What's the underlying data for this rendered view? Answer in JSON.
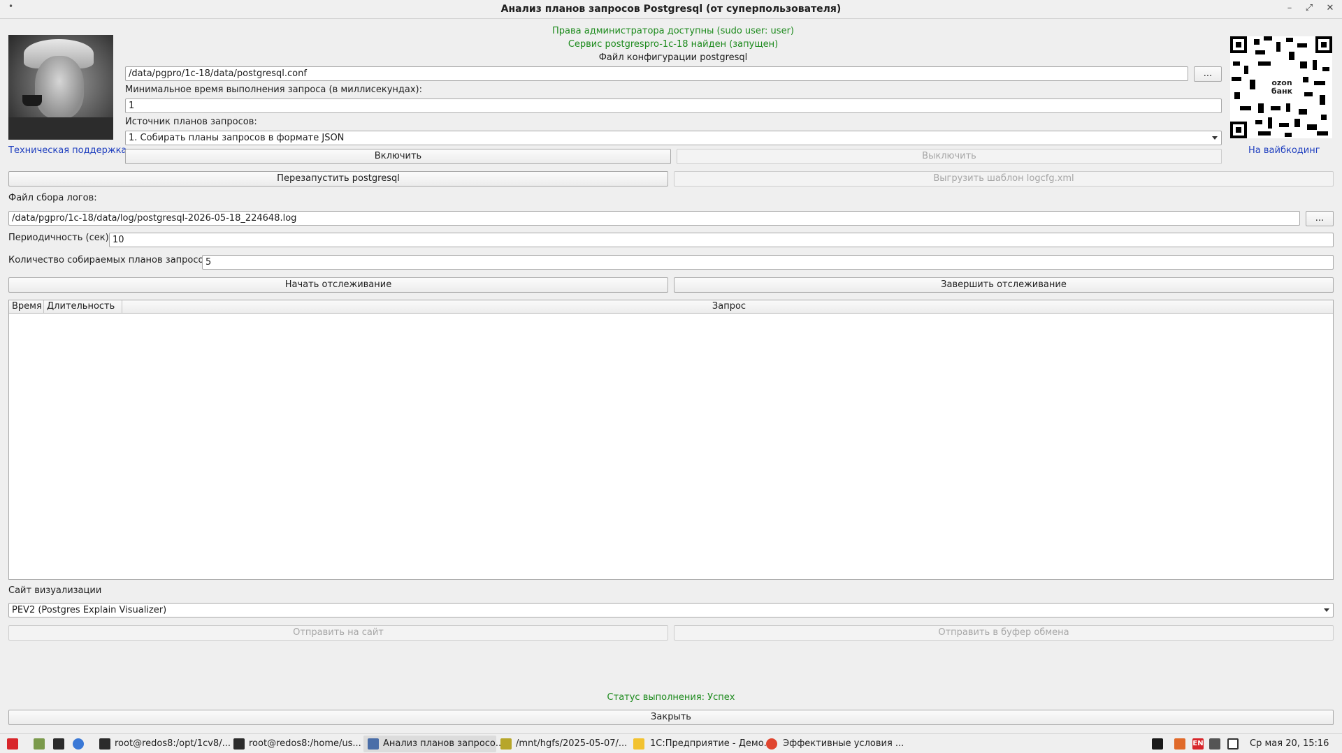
{
  "window": {
    "title": "Анализ планов запросов Postgresql (от суперпользователя)",
    "dot": "•",
    "minimize": "–",
    "maximize": "⤢",
    "close": "✕"
  },
  "status_lines": {
    "admin": "Права администратора доступны (sudo user: user)",
    "service": "Сервис postgrespro-1c-18 найден (запущен)",
    "config_label": "Файл конфигурации postgresql"
  },
  "support_link": "Техническая поддержка",
  "donate_link": "На вайбкодинг",
  "qr_brand": {
    "line1": "ozon",
    "line2": "банк"
  },
  "config": {
    "path": "/data/pgpro/1c-18/data/postgresql.conf",
    "browse": "..."
  },
  "min_time": {
    "label": "Минимальное время выполнения запроса (в миллисекундах):",
    "value": "1"
  },
  "plan_source": {
    "label": "Источник планов запросов:",
    "selected": "1. Собирать планы запросов в формате JSON"
  },
  "buttons": {
    "enable": "Включить",
    "disable": "Выключить",
    "restart": "Перезапустить postgresql",
    "export_template": "Выгрузить шаблон logcfg.xml",
    "start_tracking": "Начать отслеживание",
    "stop_tracking": "Завершить отслеживание",
    "send_site": "Отправить на сайт",
    "send_clipboard": "Отправить в буфер обмена",
    "close": "Закрыть"
  },
  "log_file": {
    "label": "Файл сбора логов:",
    "path": "/data/pgpro/1c-18/data/log/postgresql-2026-05-18_224648.log",
    "browse": "..."
  },
  "period": {
    "label": "Периодичность (сек):",
    "value": "10"
  },
  "plans_count": {
    "label": "Количество собираемых планов запросов:",
    "value": "5"
  },
  "table": {
    "columns": [
      "Время",
      "Длительность",
      "Запрос"
    ],
    "rows": []
  },
  "visualizer": {
    "label": "Сайт визуализации",
    "selected": "PEV2 (Postgres Explain Visualizer)"
  },
  "exec_status": "Статус выполнения: Успех",
  "taskbar": {
    "items": [
      "root@redos8:/opt/1cv8/...",
      "root@redos8:/home/us...",
      "Анализ планов запросо...",
      "/mnt/hgfs/2025-05-07/...",
      "1С:Предприятие - Демо...",
      "Эффективные условия ..."
    ],
    "lang": "EN",
    "clock": "Ср мая 20, 15:16"
  },
  "colors": {
    "status_green": "#1c8a1c",
    "link_blue": "#1f3fbf",
    "disabled_text": "#a6a6a6"
  }
}
